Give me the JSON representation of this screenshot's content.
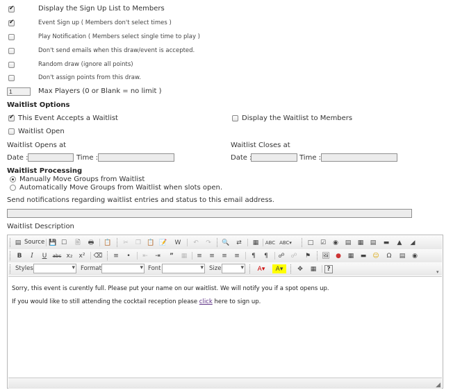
{
  "options": [
    {
      "label": "Display the Sign Up List to Members",
      "checked": true
    },
    {
      "label": "Event Sign up ( Members don't select times )",
      "checked": true
    },
    {
      "label": "Play Notification ( Members select single time to play )",
      "checked": false
    },
    {
      "label": "Don't send emails when this draw/event is accepted.",
      "checked": false
    },
    {
      "label": "Random draw (ignore all points)",
      "checked": false
    },
    {
      "label": "Don't assign points from this draw.",
      "checked": false
    }
  ],
  "max_players": {
    "value": "1",
    "label": "Max Players (0 or Blank = no limit )"
  },
  "waitlist_options": {
    "heading": "Waitlist Options",
    "accepts_waitlist": {
      "label": "This Event Accepts a Waitlist",
      "checked": true
    },
    "display_waitlist": {
      "label": "Display the Waitlist to Members",
      "checked": false
    },
    "waitlist_open": {
      "label": "Waitlist Open",
      "checked": false
    },
    "opens_at": {
      "label": "Waitlist Opens at",
      "date_label": "Date :",
      "time_label": "Time :",
      "date": "",
      "time": ""
    },
    "closes_at": {
      "label": "Waitlist Closes at",
      "date_label": "Date :",
      "time_label": "Time :",
      "date": "",
      "time": ""
    }
  },
  "waitlist_processing": {
    "heading": "Waitlist Processing",
    "choices": [
      {
        "label": "Manually Move Groups from Waitlist",
        "selected": true
      },
      {
        "label": "Automatically Move Groups from Waitlist when slots open.",
        "selected": false
      }
    ]
  },
  "notification": {
    "label": "Send notifications regarding waitlist entries and status to this email address.",
    "value": ""
  },
  "description": {
    "label": "Waitlist Description",
    "toolbar": {
      "source_label": "Source",
      "styles_label": "Styles",
      "format_label": "Format",
      "font_label": "Font",
      "size_label": "Size"
    },
    "paragraph1": "Sorry, this event is curently full.  Please put your name on our waitlist.  We will notify you if a spot opens up.",
    "paragraph2_before": "If you would like to still attending the cocktail reception please ",
    "paragraph2_link": "click",
    "paragraph2_after": " here to sign up."
  }
}
